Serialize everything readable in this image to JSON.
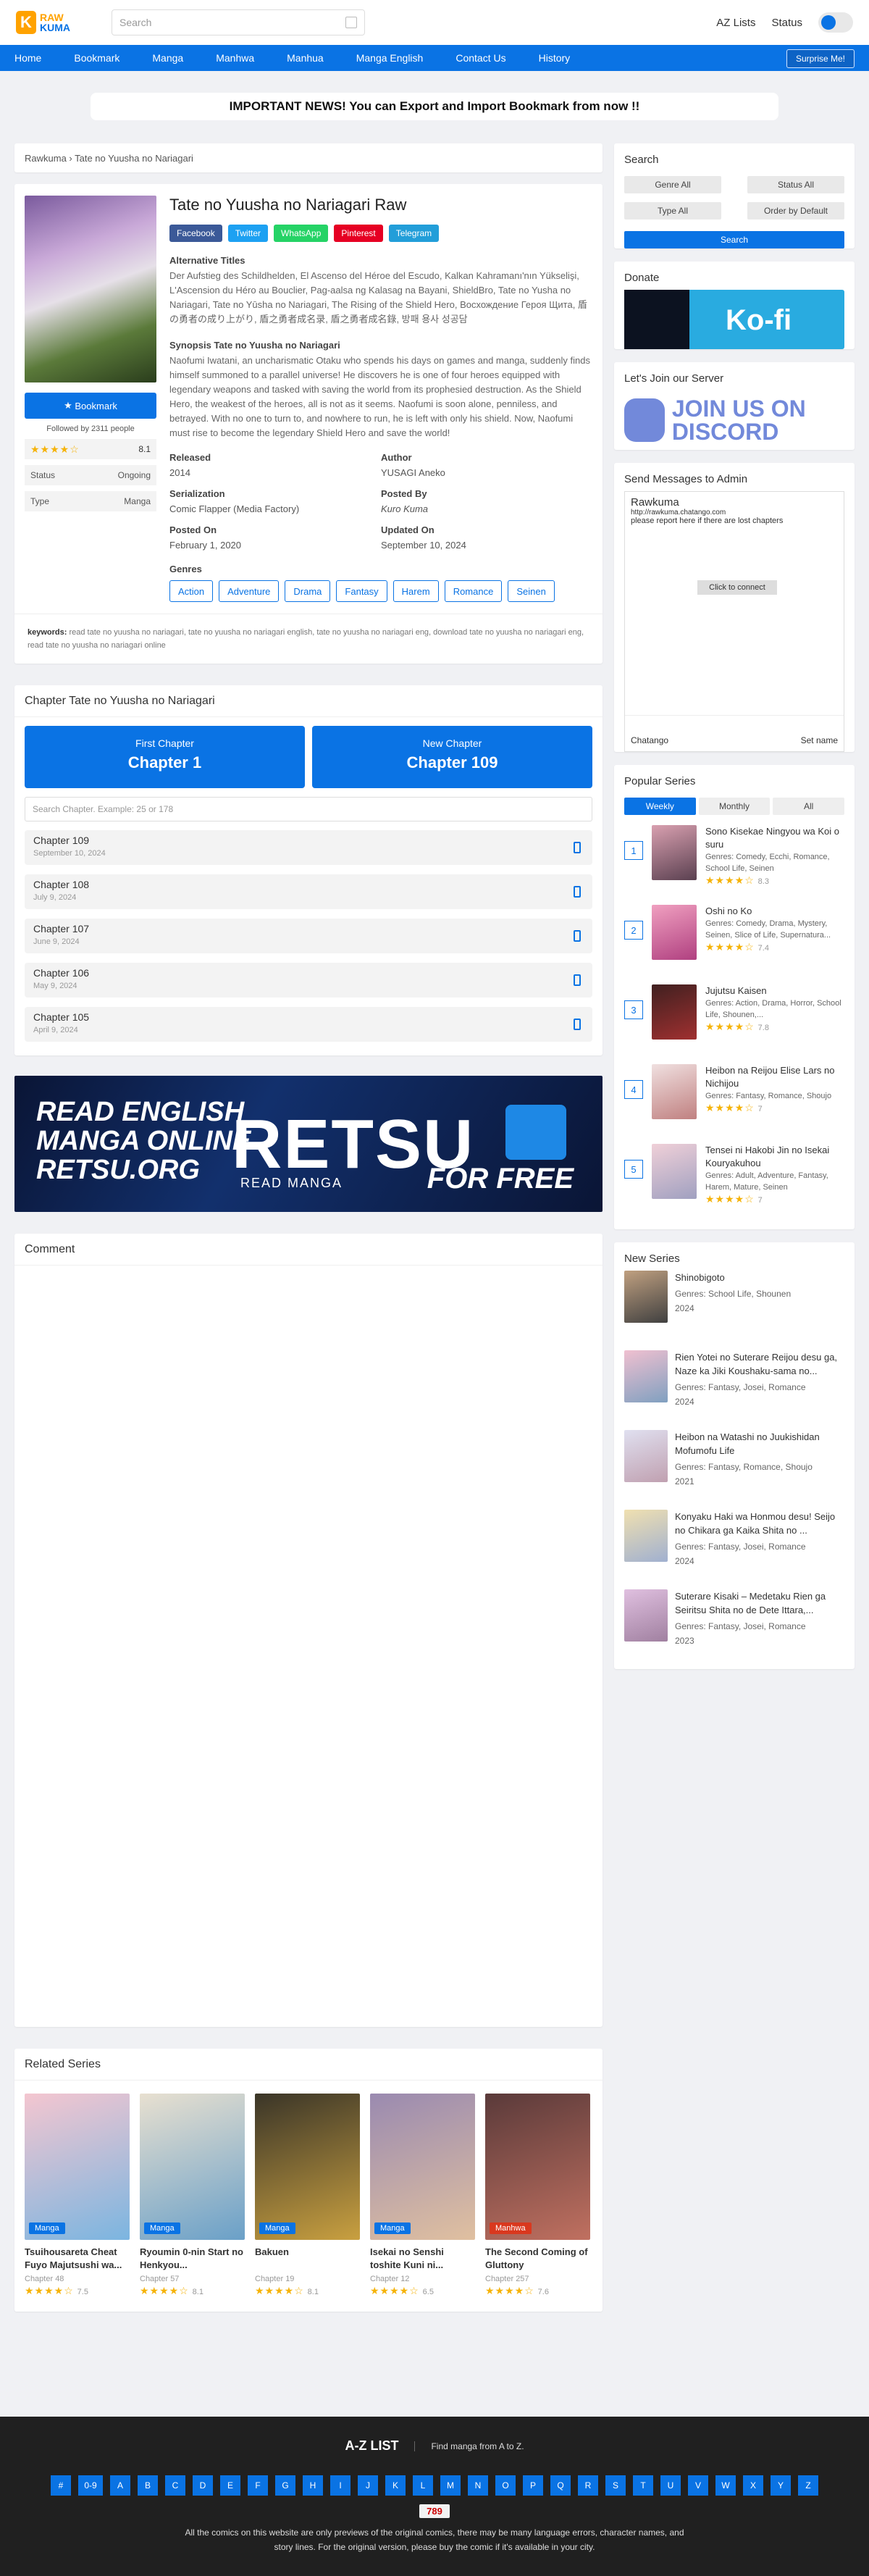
{
  "header": {
    "logo_top": "RAW",
    "logo_bottom": "KUMA",
    "search_placeholder": "Search",
    "az_lists": "AZ Lists",
    "status": "Status"
  },
  "nav": {
    "items": [
      "Home",
      "Bookmark",
      "Manga",
      "Manhwa",
      "Manhua",
      "Manga English",
      "Contact Us",
      "History"
    ],
    "surprise": "Surprise Me!"
  },
  "notice": "IMPORTANT NEWS! You can Export and Import Bookmark from now !!",
  "breadcrumb": "Rawkuma › Tate no Yuusha no Nariagari",
  "series": {
    "title": "Tate no Yuusha no Nariagari Raw",
    "bookmark": "Bookmark",
    "followed": "Followed by 2311 people",
    "rating": "8.1",
    "status_label": "Status",
    "status_value": "Ongoing",
    "type_label": "Type",
    "type_value": "Manga",
    "share": [
      "Facebook",
      "Twitter",
      "WhatsApp",
      "Pinterest",
      "Telegram"
    ],
    "alt_title_h": "Alternative Titles",
    "alt_titles": "Der Aufstieg des Schildhelden, El Ascenso del Héroe del Escudo, Kalkan Kahramanı'nın Yükselişi, L'Ascension du Héro au Bouclier, Pag-aalsa ng Kalasag na Bayani, ShieldBro, Tate no Yusha no Nariagari, Tate no Yūsha no Nariagari, The Rising of the Shield Hero, Восхождение Героя Щита, 盾の勇者の成り上がり, 盾之勇者成名录, 盾之勇者成名錄, 방패 용사 성공담",
    "synopsis_h": "Synopsis Tate no Yuusha no Nariagari",
    "synopsis": "Naofumi Iwatani, an uncharismatic Otaku who spends his days on games and manga, suddenly finds himself summoned to a parallel universe! He discovers he is one of four heroes equipped with legendary weapons and tasked with saving the world from its prophesied destruction. As the Shield Hero, the weakest of the heroes, all is not as it seems. Naofumi is soon alone, penniless, and betrayed. With no one to turn to, and nowhere to run, he is left with only his shield. Now, Naofumi must rise to become the legendary Shield Hero and save the world!",
    "released_l": "Released",
    "released": "2014",
    "author_l": "Author",
    "author": "YUSAGI Aneko",
    "serial_l": "Serialization",
    "serial": "Comic Flapper (Media Factory)",
    "posted_by_l": "Posted By",
    "posted_by": "Kuro Kuma",
    "posted_on_l": "Posted On",
    "posted_on": "February 1, 2020",
    "updated_l": "Updated On",
    "updated": "September 10, 2024",
    "genres_l": "Genres",
    "genres": [
      "Action",
      "Adventure",
      "Drama",
      "Fantasy",
      "Harem",
      "Romance",
      "Seinen"
    ],
    "keywords_l": "keywords:",
    "keywords": "read tate no yuusha no nariagari, tate no yuusha no nariagari english, tate no yuusha no nariagari eng, download tate no yuusha no nariagari eng, read tate no yuusha no nariagari online"
  },
  "chapters": {
    "heading": "Chapter Tate no Yuusha no Nariagari",
    "first_l": "First Chapter",
    "first": "Chapter 1",
    "new_l": "New Chapter",
    "new": "Chapter 109",
    "search_placeholder": "Search Chapter. Example: 25 or 178",
    "list": [
      {
        "name": "Chapter 109",
        "date": "September 10, 2024"
      },
      {
        "name": "Chapter 108",
        "date": "July 9, 2024"
      },
      {
        "name": "Chapter 107",
        "date": "June 9, 2024"
      },
      {
        "name": "Chapter 106",
        "date": "May 9, 2024"
      },
      {
        "name": "Chapter 105",
        "date": "April 9, 2024"
      }
    ]
  },
  "banner": {
    "l1": "READ ENGLISH",
    "l2": "MANGA ONLINE",
    "l3": "RETSU.ORG",
    "brand": "RETSU",
    "sub": "READ MANGA",
    "free": "FOR FREE"
  },
  "comment_h": "Comment",
  "related": {
    "heading": "Related Series",
    "items": [
      {
        "title": "Tsuihousareta Cheat Fuyo Majutsushi wa...",
        "ch": "Chapter 48",
        "r": "7.5",
        "tag": "Manga",
        "tc": "#0a73e4",
        "c1": "#f4c6d0",
        "c2": "#7bb5e0"
      },
      {
        "title": "Ryoumin 0-nin Start no Henkyou...",
        "ch": "Chapter 57",
        "r": "8.1",
        "tag": "Manga",
        "tc": "#0a73e4",
        "c1": "#e8e0d0",
        "c2": "#6aa0c8"
      },
      {
        "title": "Bakuen",
        "ch": "Chapter 19",
        "r": "8.1",
        "tag": "Manga",
        "tc": "#0a73e4",
        "c1": "#3a3528",
        "c2": "#c9a040"
      },
      {
        "title": "Isekai no Senshi toshite Kuni ni...",
        "ch": "Chapter 12",
        "r": "6.5",
        "tag": "Manga",
        "tc": "#0a73e4",
        "c1": "#9a8ab0",
        "c2": "#e0c0a0"
      },
      {
        "title": "The Second Coming of Gluttony",
        "ch": "Chapter 257",
        "r": "7.6",
        "tag": "Manhwa",
        "tc": "#d9381e",
        "c1": "#5a3a3a",
        "c2": "#c07060"
      }
    ]
  },
  "sidebar": {
    "search_h": "Search",
    "filters": [
      "Genre All",
      "Status All",
      "Type All",
      "Order by Default"
    ],
    "search_btn": "Search",
    "donate_h": "Donate",
    "kofi": "Ko-fi",
    "server_h": "Let's Join our Server",
    "discord": "JOIN US ON DISCORD",
    "admin_h": "Send Messages to Admin",
    "chat_title": "Rawkuma",
    "chat_url": "http://rawkuma.chatango.com",
    "chat_desc": "please report here if there are lost chapters",
    "chat_connect": "Click to connect",
    "chat_brand": "Chatango",
    "chat_setname": "Set name",
    "popular_h": "Popular Series",
    "tabs": [
      "Weekly",
      "Monthly",
      "All"
    ],
    "popular": [
      {
        "n": "1",
        "title": "Sono Kisekae Ningyou wa Koi o suru",
        "genres": "Comedy, Ecchi, Romance, School Life, Seinen",
        "r": "8.3",
        "c1": "#d9a0b0",
        "c2": "#5a4050"
      },
      {
        "n": "2",
        "title": "Oshi no Ko",
        "genres": "Comedy, Drama, Mystery, Seinen, Slice of Life, Supernatura...",
        "r": "7.4",
        "c1": "#f0a0c0",
        "c2": "#b04080"
      },
      {
        "n": "3",
        "title": "Jujutsu Kaisen",
        "genres": "Action, Drama, Horror, School Life, Shounen,...",
        "r": "7.8",
        "c1": "#402020",
        "c2": "#a03030"
      },
      {
        "n": "4",
        "title": "Heibon na Reijou Elise Lars no Nichijou",
        "genres": "Fantasy, Romance, Shoujo",
        "r": "7",
        "c1": "#f0e0e0",
        "c2": "#c08080"
      },
      {
        "n": "5",
        "title": "Tensei ni Hakobi Jin no Isekai Kouryakuhou",
        "genres": "Adult, Adventure, Fantasy, Harem, Mature, Seinen",
        "r": "7",
        "c1": "#f0d0d8",
        "c2": "#a0a0c0"
      }
    ],
    "genres_l": "Genres:",
    "new_h": "New Series",
    "new": [
      {
        "title": "Shinobigoto",
        "genres": "School Life, Shounen",
        "year": "2024",
        "c1": "#c0a080",
        "c2": "#404040"
      },
      {
        "title": "Rien Yotei no Suterare Reijou desu ga, Naze ka Jiki Koushaku-sama no...",
        "genres": "Fantasy, Josei, Romance",
        "year": "2024",
        "c1": "#f0c0d0",
        "c2": "#80a0c0"
      },
      {
        "title": "Heibon na Watashi no Juukishidan Mofumofu Life",
        "genres": "Fantasy, Romance, Shoujo",
        "year": "2021",
        "c1": "#e0e0f0",
        "c2": "#c0a0b0"
      },
      {
        "title": "Konyaku Haki wa Honmou desu! Seijo no Chikara ga Kaika Shita no ...",
        "genres": "Fantasy, Josei, Romance",
        "year": "2024",
        "c1": "#f0e0b0",
        "c2": "#a0b0d0"
      },
      {
        "title": "Suterare Kisaki – Medetaku Rien ga Seiritsu Shita no de Dete Ittara,...",
        "genres": "Fantasy, Josei, Romance",
        "year": "2023",
        "c1": "#e0c0e0",
        "c2": "#a080a0"
      }
    ]
  },
  "footer": {
    "az_h": "A-Z LIST",
    "az_sub": "Find manga from A to Z.",
    "letters": [
      "#",
      "0-9",
      "A",
      "B",
      "C",
      "D",
      "E",
      "F",
      "G",
      "H",
      "I",
      "J",
      "K",
      "L",
      "M",
      "N",
      "O",
      "P",
      "Q",
      "R",
      "S",
      "T",
      "U",
      "V",
      "W",
      "X",
      "Y",
      "Z"
    ],
    "counter": "789",
    "note": "All the comics on this website are only previews of the original comics, there may be many language errors, character names, and story lines. For the original version, please buy the comic if it's available in your city."
  },
  "colors": {
    "accent": "#0a73e4",
    "logo": "#ffa200"
  }
}
